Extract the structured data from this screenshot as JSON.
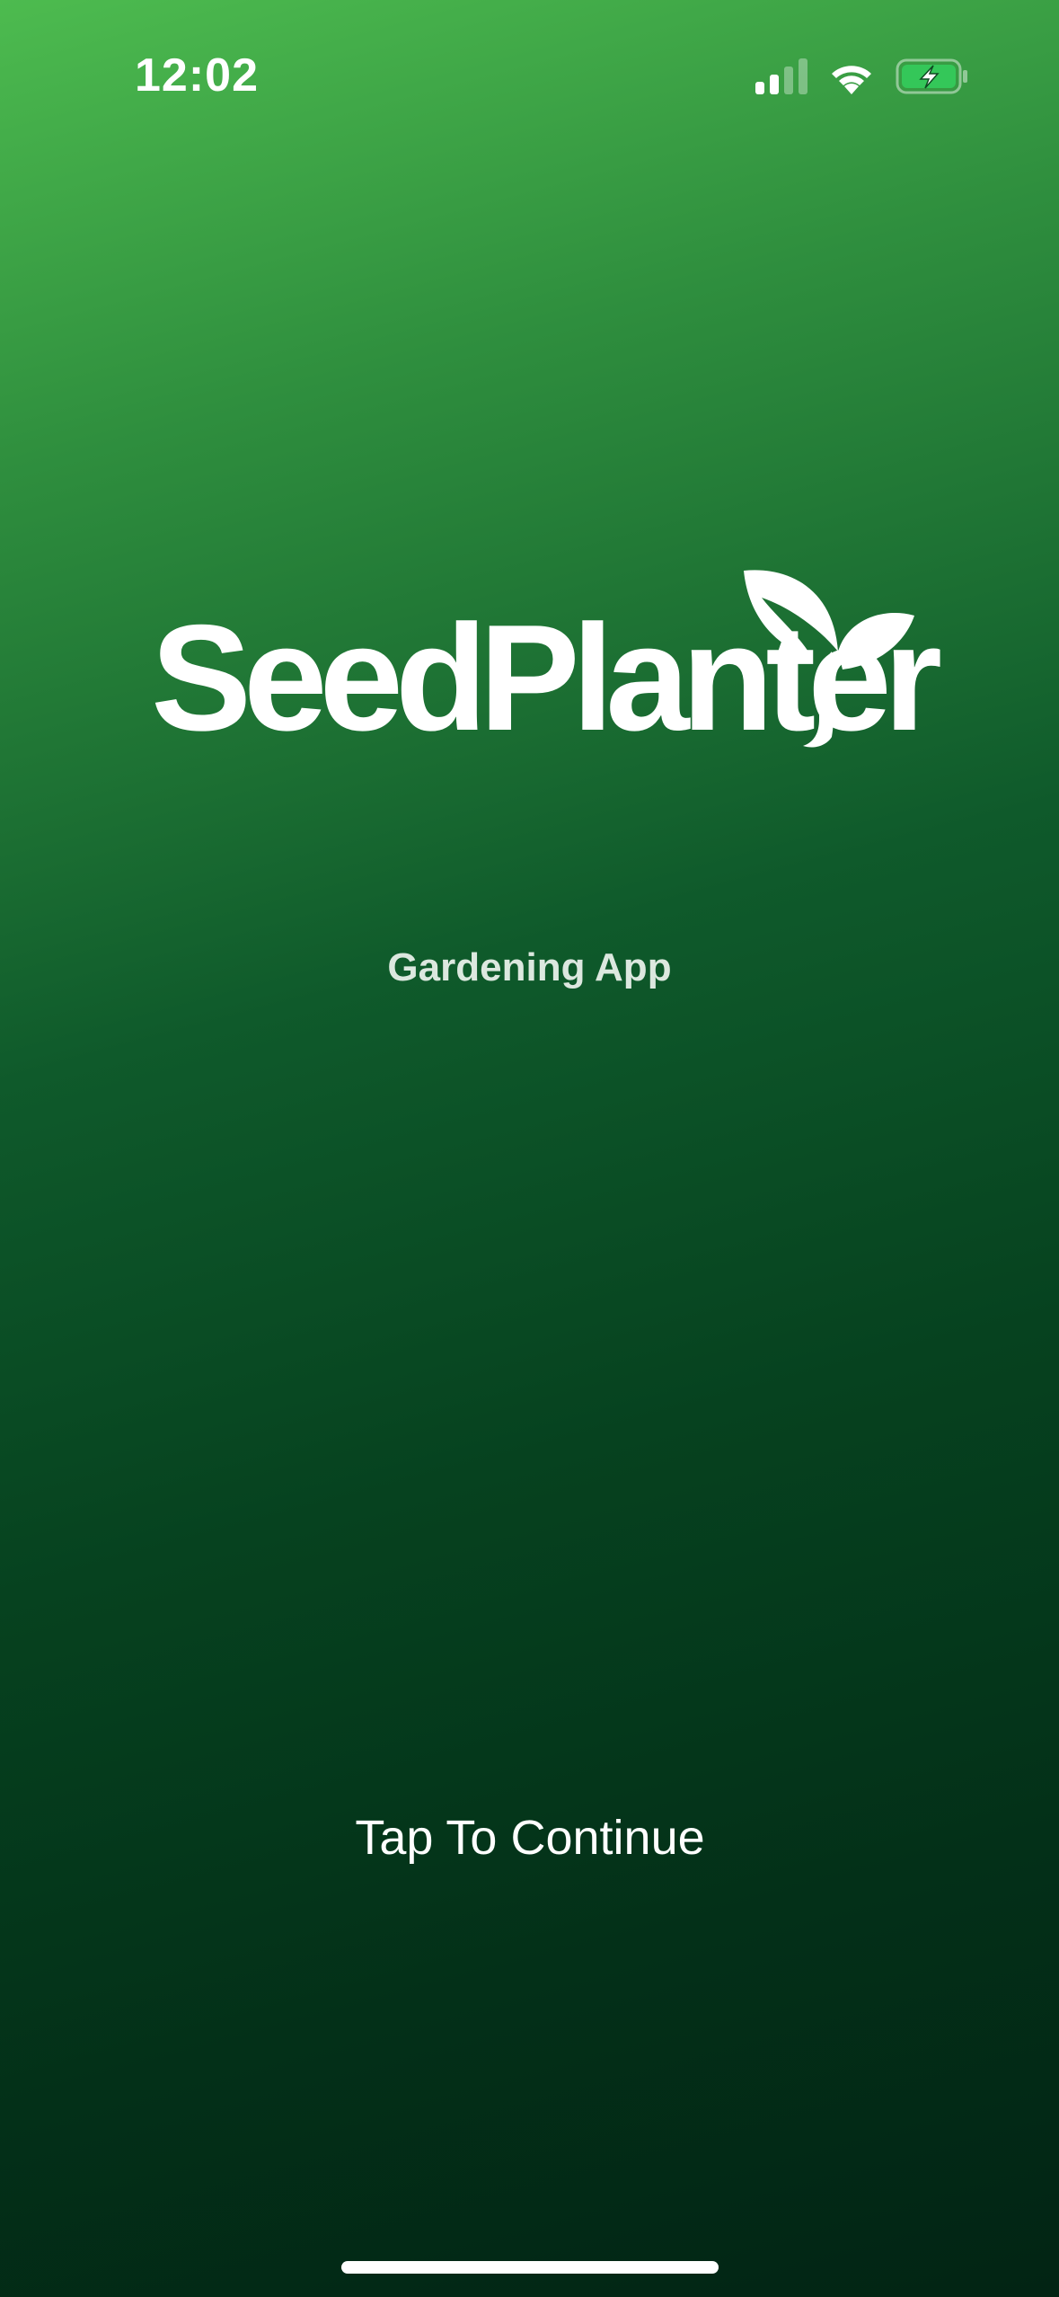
{
  "status_bar": {
    "time": "12:02",
    "icons": [
      "cellular-signal-icon",
      "wifi-icon",
      "battery-charging-icon"
    ],
    "battery_color": "#34c759"
  },
  "app": {
    "logo_text": "SeedPlanter",
    "subtitle": "Gardening App",
    "continue_label": "Tap To Continue"
  },
  "colors": {
    "gradient_top": "#4dbb4f",
    "gradient_bottom": "#022414",
    "text": "#ffffff"
  }
}
